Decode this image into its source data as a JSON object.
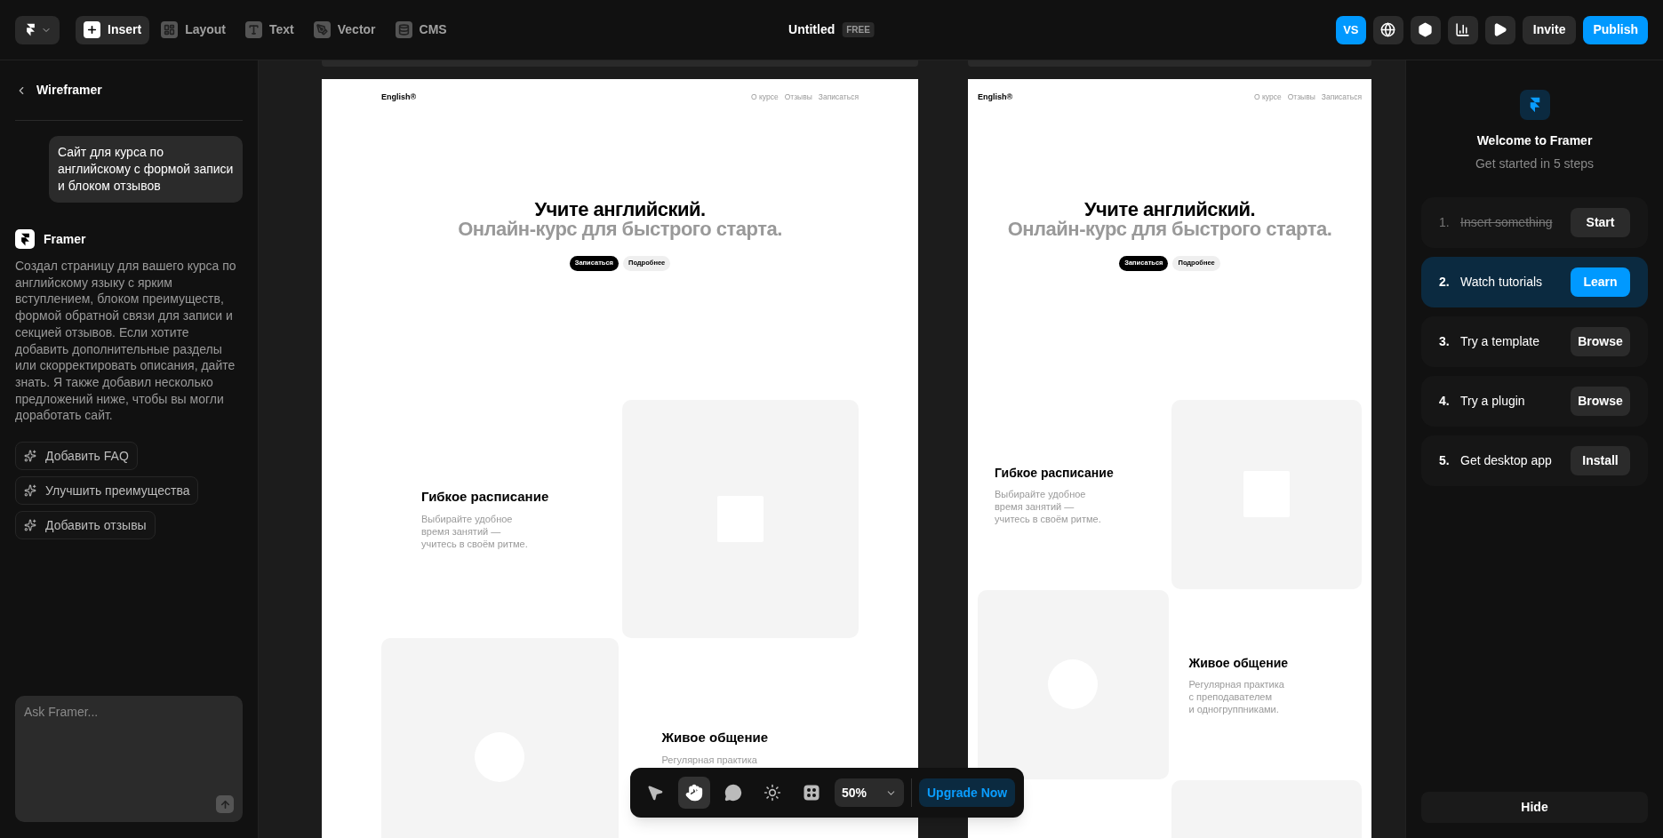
{
  "topbar": {
    "tabs": [
      {
        "label": "Insert",
        "selected": true
      },
      {
        "label": "Layout",
        "selected": false
      },
      {
        "label": "Text",
        "selected": false
      },
      {
        "label": "Vector",
        "selected": false
      },
      {
        "label": "CMS",
        "selected": false
      }
    ],
    "title": "Untitled",
    "plan": "FREE",
    "avatar": "VS",
    "invite": "Invite",
    "publish": "Publish"
  },
  "chat": {
    "title": "Wireframer",
    "user_message": "Сайт для курса по английскому с формой записи и блоком отзывов",
    "assistant": "Framer",
    "reply": "Создал страницу для вашего курса по английскому языку с ярким вступлением, блоком преимуществ, формой обратной связи для записи и секцией отзывов. Если хотите добавить дополнительные разделы или скорректировать описания, дайте знать. Я также добавил несколько предложений ниже, чтобы вы могли доработать сайт.",
    "suggestions": [
      "Добавить FAQ",
      "Улучшить преимущества",
      "Добавить отзывы"
    ],
    "input": {
      "placeholder": "Ask Framer..."
    }
  },
  "frames": [
    {
      "kind": "desktop",
      "logo": "English®",
      "links": [
        "О курсе",
        "Отзывы",
        "Записаться"
      ],
      "title": "Учите английский.",
      "subtitle": "Онлайн-курс для быстрого старта.",
      "buttons": [
        "Записаться",
        "Подробнее"
      ],
      "features": [
        {
          "title": "Гибкое расписание",
          "lines": [
            "Выбирайте удобное",
            "время занятий —",
            "учитесь в своём ритме."
          ]
        },
        {
          "title": "Живое общение",
          "lines": [
            "Регулярная практика"
          ]
        }
      ]
    },
    {
      "kind": "tablet",
      "logo": "English®",
      "links": [
        "О курсе",
        "Отзывы",
        "Записаться"
      ],
      "title": "Учите английский.",
      "subtitle": "Онлайн-курс для быстрого старта.",
      "buttons": [
        "Записаться",
        "Подробнее"
      ],
      "features": [
        {
          "title": "Гибкое расписание",
          "lines": [
            "Выбирайте удобное",
            "время занятий —",
            "учитесь в своём ритме."
          ]
        },
        {
          "title": "Живое общение",
          "lines": [
            "Регулярная практика",
            "с преподавателем",
            "и одногруппниками."
          ]
        }
      ]
    }
  ],
  "toolbar": {
    "tools": [
      {
        "selected": false
      },
      {
        "selected": true
      },
      {
        "selected": false
      },
      {
        "selected": false
      },
      {
        "selected": false
      }
    ],
    "zoom": "50%",
    "upgrade": "Upgrade Now"
  },
  "welcome": {
    "title": "Welcome to Framer",
    "subtitle": "Get started in 5 steps",
    "steps": [
      {
        "number": "1.",
        "label": "Insert something",
        "action": "Start",
        "completed": true,
        "selected": false
      },
      {
        "number": "2.",
        "label": "Watch tutorials",
        "action": "Learn",
        "completed": false,
        "selected": true
      },
      {
        "number": "3.",
        "label": "Try a template",
        "action": "Browse",
        "completed": false,
        "selected": false
      },
      {
        "number": "4.",
        "label": "Try a plugin",
        "action": "Browse",
        "completed": false,
        "selected": false
      },
      {
        "number": "5.",
        "label": "Get desktop app",
        "action": "Install",
        "completed": false,
        "selected": false
      }
    ],
    "hide": "Hide"
  }
}
